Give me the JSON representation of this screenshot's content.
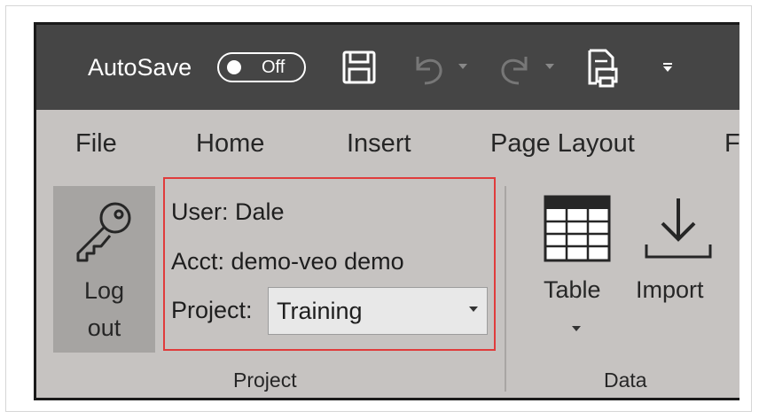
{
  "quick_access": {
    "autosave_label": "AutoSave",
    "autosave_state": "Off",
    "icons": [
      "save-icon",
      "undo-icon",
      "redo-icon",
      "print-preview-icon",
      "customize-dropdown-icon"
    ]
  },
  "tabs": [
    {
      "label": "File"
    },
    {
      "label": "Home"
    },
    {
      "label": "Insert"
    },
    {
      "label": "Page Layout"
    },
    {
      "label": "Fo"
    }
  ],
  "project_group": {
    "logout_label_line1": "Log",
    "logout_label_line2": "out",
    "user": "User: Dale",
    "account": "Acct: demo-veo demo",
    "project_label": "Project:",
    "project_value": "Training",
    "group_label": "Project"
  },
  "data_group": {
    "table_label": "Table",
    "import_label": "Import",
    "group_label": "Data"
  },
  "colors": {
    "title_bar": "#454545",
    "ribbon": "#c6c3c1",
    "highlight_box": "#e03c3c"
  }
}
